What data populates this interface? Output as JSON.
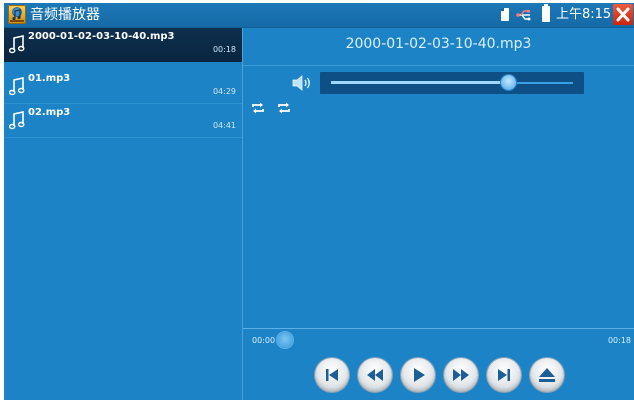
{
  "app": {
    "title": "音频播放器",
    "icon": "music-app-icon",
    "close_icon": "close-icon"
  },
  "status": {
    "time": "上午8:15",
    "icons": [
      "sd-card-icon",
      "usb-icon",
      "battery-icon"
    ]
  },
  "playlist": {
    "items": [
      {
        "name": "2000-01-02-03-10-40.mp3",
        "duration": "00:18",
        "selected": true,
        "icon": "music-note-icon"
      },
      {
        "name": "01.mp3",
        "duration": "04:29",
        "selected": false,
        "icon": "music-note-icon"
      },
      {
        "name": "02.mp3",
        "duration": "04:41",
        "selected": false,
        "icon": "music-note-icon"
      }
    ]
  },
  "player": {
    "now_playing": "2000-01-02-03-10-40.mp3",
    "volume": {
      "icon": "speaker-icon",
      "level": 0.73
    },
    "repeat_icons": [
      "repeat-all-icon",
      "repeat-one-icon"
    ],
    "elapsed": "00:00",
    "total": "00:18",
    "seek_fraction": 0.0,
    "controls": [
      "skip-previous-icon",
      "rewind-icon",
      "play-icon",
      "fast-forward-icon",
      "skip-next-icon",
      "eject-icon"
    ]
  },
  "colors": {
    "background": "#1c84c6",
    "selected_row": "#0e2f4e",
    "volume_track": "#0e4f86",
    "close_button": "#d9361a"
  }
}
